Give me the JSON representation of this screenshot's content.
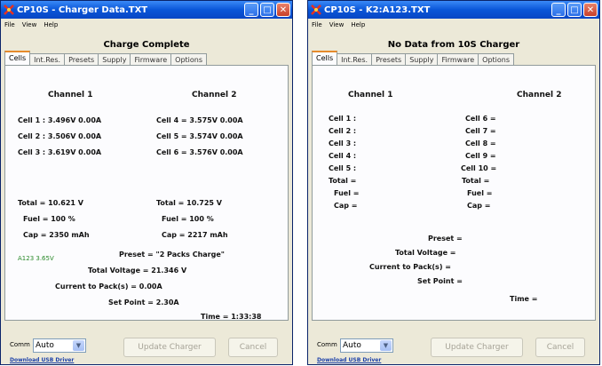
{
  "windows": [
    {
      "title": "CP10S - Charger Data.TXT",
      "menu": [
        "File",
        "View",
        "Help"
      ],
      "status_title": "Charge Complete",
      "tabs": [
        "Cells",
        "Int.Res.",
        "Presets",
        "Supply",
        "Firmware",
        "Options"
      ],
      "active_tab": "Cells",
      "channel1_header": "Channel 1",
      "channel2_header": "Channel 2",
      "cells_ch1": [
        "Cell 1 :  3.496V  0.00A",
        "Cell 2 :  3.506V  0.00A",
        "Cell 3 :  3.619V  0.00A"
      ],
      "cells_ch2": [
        "Cell 4 =  3.575V  0.00A",
        "Cell 5 =  3.574V  0.00A",
        "Cell 6 =  3.576V  0.00A"
      ],
      "ch1_summary": [
        "Total =   10.621 V",
        "Fuel =   100 %",
        "Cap =   2350 mAh"
      ],
      "ch2_summary": [
        "Total =   10.725 V",
        "Fuel =   100 %",
        "Cap =   2217 mAh"
      ],
      "battery_tag": "A123 3.65V",
      "preset": "Preset =  \"2 Packs Charge\"",
      "total_voltage": "Total Voltage =  21.346 V",
      "current_to_packs": "Current to Pack(s) =  0.00A",
      "set_point": "Set Point =  2.30A",
      "time": "Time =  1:33:38",
      "comm_label": "Comm",
      "comm_value": "Auto",
      "update_button": "Update Charger",
      "cancel_button": "Cancel",
      "driver_link": "Download USB Driver"
    },
    {
      "title": "CP10S - K2:A123.TXT",
      "menu": [
        "File",
        "View",
        "Help"
      ],
      "status_title": "No Data from 10S Charger",
      "tabs": [
        "Cells",
        "Int.Res.",
        "Presets",
        "Supply",
        "Firmware",
        "Options"
      ],
      "active_tab": "Cells",
      "channel1_header": "Channel 1",
      "channel2_header": "Channel 2",
      "cells_ch1": [
        "Cell 1 :",
        "Cell 2 :",
        "Cell 3 :",
        "Cell 4 :",
        "Cell 5 :"
      ],
      "cells_ch2": [
        "Cell 6 =",
        "Cell 7 =",
        "Cell 8 =",
        "Cell 9 =",
        "Cell 10 ="
      ],
      "ch1_summary": [
        "Total =",
        "Fuel =",
        "Cap ="
      ],
      "ch2_summary": [
        "Total =",
        "Fuel =",
        "Cap ="
      ],
      "preset": "Preset =",
      "total_voltage": "Total Voltage =",
      "current_to_packs": "Current to Pack(s) =",
      "set_point": "Set Point =",
      "time": "Time =",
      "comm_label": "Comm",
      "comm_value": "Auto",
      "update_button": "Update Charger",
      "cancel_button": "Cancel",
      "driver_link": "Download USB Driver"
    }
  ],
  "colors": {
    "titlebar": "#0a56d8",
    "window_bg": "#ece9d8",
    "panel_bg": "#fcfcfe",
    "battery_tag": "#2a8a2a",
    "link": "#1a3fa8"
  },
  "icons": {
    "app": "cp10s-app-icon",
    "minimize": "minimize-icon",
    "maximize": "maximize-icon",
    "close": "close-icon",
    "dropdown": "chevron-down-icon"
  }
}
